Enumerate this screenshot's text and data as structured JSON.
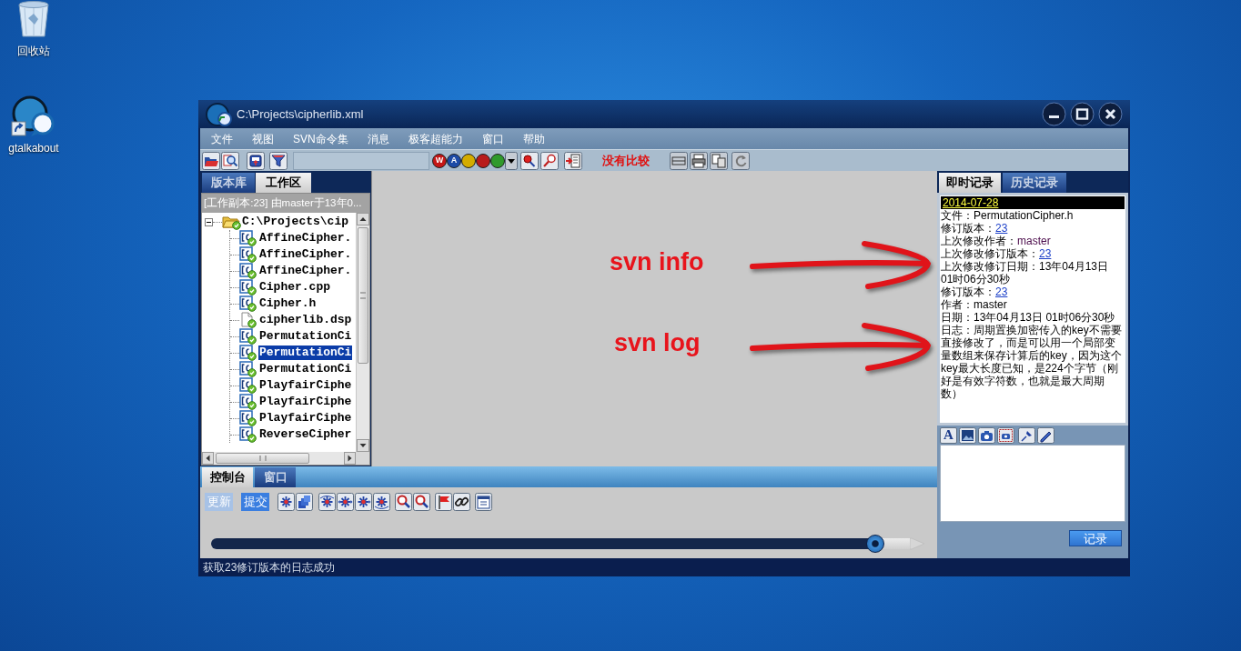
{
  "desktop_icons": [
    {
      "label": "回收站",
      "kind": "recycle-bin"
    },
    {
      "label": "gtalkabout",
      "kind": "shortcut"
    }
  ],
  "window": {
    "title": "C:\\Projects\\cipherlib.xml"
  },
  "menu": [
    "文件",
    "视图",
    "SVN命令集",
    "消息",
    "极客超能力",
    "窗口",
    "帮助"
  ],
  "toolbar": {
    "color_buttons": [
      {
        "label": "W",
        "color": "#c41616"
      },
      {
        "label": "A",
        "color": "#1c4aa6"
      },
      {
        "color": "#d4ac00"
      },
      {
        "color": "#b81c1c"
      },
      {
        "color": "#2f9a2c"
      }
    ],
    "compare_status": "没有比较"
  },
  "left_panel": {
    "tabs": [
      {
        "label": "版本库",
        "selected": false
      },
      {
        "label": "工作区",
        "selected": true
      }
    ],
    "header": "[工作副本:23] 由master于13年0...",
    "tree": {
      "label": "C:\\Projects\\cip",
      "kind": "folder",
      "expanded": true,
      "selected": false,
      "children": [
        {
          "label": "AffineCipher.",
          "kind": "source",
          "selected": false
        },
        {
          "label": "AffineCipher.",
          "kind": "source",
          "selected": false
        },
        {
          "label": "AffineCipher.",
          "kind": "source",
          "selected": false
        },
        {
          "label": "Cipher.cpp",
          "kind": "source",
          "selected": false
        },
        {
          "label": "Cipher.h",
          "kind": "source",
          "selected": false
        },
        {
          "label": "cipherlib.dsp",
          "kind": "file",
          "selected": false
        },
        {
          "label": "PermutationCi",
          "kind": "source",
          "selected": false
        },
        {
          "label": "PermutationCi",
          "kind": "source",
          "selected": true
        },
        {
          "label": "PermutationCi",
          "kind": "source",
          "selected": false
        },
        {
          "label": "PlayfairCiphe",
          "kind": "source",
          "selected": false
        },
        {
          "label": "PlayfairCiphe",
          "kind": "source",
          "selected": false
        },
        {
          "label": "PlayfairCiphe",
          "kind": "source",
          "selected": false
        },
        {
          "label": "ReverseCipher",
          "kind": "source",
          "selected": false
        }
      ]
    }
  },
  "annotations": [
    {
      "label": "svn info"
    },
    {
      "label": "svn log"
    }
  ],
  "right_panel": {
    "tabs": [
      {
        "label": "即时记录",
        "selected": true
      },
      {
        "label": "历史记录",
        "selected": false
      }
    ],
    "date": "2014-07-28",
    "info_lines": [
      {
        "label": "文件：",
        "value": "PermutationCipher.h",
        "kind": "text"
      },
      {
        "label": "修订版本：",
        "value": "23",
        "kind": "link"
      },
      {
        "label": "上次修改作者：",
        "value": "master",
        "kind": "author"
      },
      {
        "label": "上次修改修订版本：",
        "value": "23",
        "kind": "link"
      },
      {
        "label": "上次修改修订日期：",
        "value": "13年04月13日 01时06分30秒",
        "kind": "text"
      },
      {
        "label": "修订版本：",
        "value": "23",
        "kind": "link"
      },
      {
        "label": "作者：",
        "value": "master",
        "kind": "text"
      },
      {
        "label": "日期：",
        "value": "13年04月13日 01时06分30秒",
        "kind": "text"
      },
      {
        "label": "日志：",
        "value": "周期置换加密传入的key不需要直接修改了，而是可以用一个局部变量数组来保存计算后的key，因为这个key最大长度已知，是224个字节（刚好是有效字符数，也就是最大周期数）",
        "kind": "text"
      }
    ],
    "font_button": "A",
    "record_button": "记录"
  },
  "console": {
    "tabs": [
      {
        "label": "控制台",
        "selected": true
      },
      {
        "label": "窗口",
        "selected": false
      }
    ],
    "buttons": [
      {
        "label": "更新",
        "disabled": true
      },
      {
        "label": "提交",
        "disabled": false
      }
    ],
    "progress": {
      "level": 0.95
    }
  },
  "status_bar": "获取23修订版本的日志成功"
}
